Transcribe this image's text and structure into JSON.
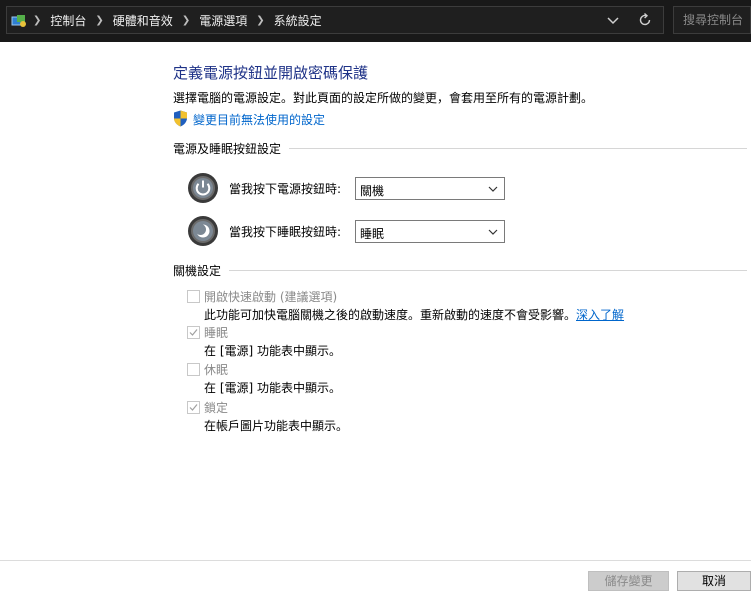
{
  "address_bar": {
    "breadcrumbs": [
      "控制台",
      "硬體和音效",
      "電源選項",
      "系統設定"
    ],
    "search_placeholder": "搜尋控制台"
  },
  "page": {
    "title": "定義電源按鈕並開啟密碼保護",
    "description": "選擇電腦的電源設定。對此頁面的設定所做的變更，會套用至所有的電源計劃。",
    "change_settings_link": "變更目前無法使用的設定"
  },
  "power_section": {
    "heading": "電源及睡眠按鈕設定",
    "power_button": {
      "label": "當我按下電源按鈕時:",
      "value": "關機"
    },
    "sleep_button": {
      "label": "當我按下睡眠按鈕時:",
      "value": "睡眠"
    }
  },
  "shutdown_section": {
    "heading": "關機設定",
    "fast_startup": {
      "label": "開啟快速啟動 (建議選項)",
      "description": "此功能可加快電腦關機之後的啟動速度。重新啟動的速度不會受影響。",
      "learn_more": "深入了解",
      "checked": false
    },
    "sleep": {
      "label": "睡眠",
      "description": "在 [電源] 功能表中顯示。",
      "checked": true
    },
    "hibernate": {
      "label": "休眠",
      "description": "在 [電源] 功能表中顯示。",
      "checked": false
    },
    "lock": {
      "label": "鎖定",
      "description": "在帳戶圖片功能表中顯示。",
      "checked": true
    }
  },
  "footer": {
    "save_label": "儲存變更",
    "cancel_label": "取消"
  },
  "colors": {
    "title_blue": "#1e3287",
    "link_blue": "#0066cc",
    "topbar_bg": "#191919"
  },
  "icons": [
    "control-panel-icon",
    "chevron-right-icon",
    "chevron-down-icon",
    "refresh-icon",
    "uac-shield-icon",
    "power-icon",
    "sleep-moon-icon",
    "checkmark-icon"
  ]
}
